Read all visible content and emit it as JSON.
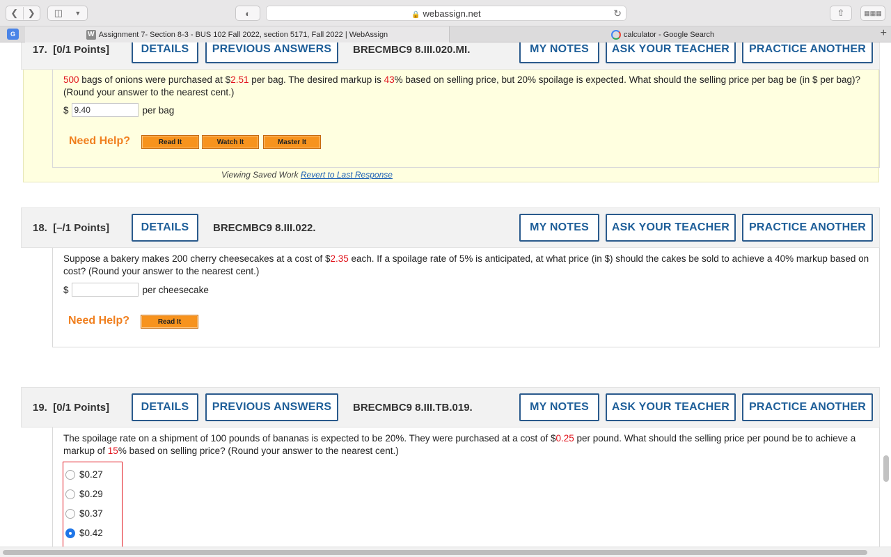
{
  "browser": {
    "url": "webassign.net",
    "tabs": [
      {
        "favicon": "W",
        "title": "Assignment 7- Section 8-3 - BUS 102 Fall 2022, section 5171, Fall 2022 | WebAssign"
      },
      {
        "favicon": "G",
        "title": "calculator - Google Search"
      }
    ],
    "translate_icon": "G"
  },
  "buttons": {
    "details": "DETAILS",
    "previous_answers": "PREVIOUS ANSWERS",
    "my_notes": "MY NOTES",
    "ask_teacher": "ASK YOUR TEACHER",
    "practice_another": "PRACTICE ANOTHER",
    "read_it": "Read It",
    "watch_it": "Watch It",
    "master_it": "Master It"
  },
  "need_help": "Need Help?",
  "questions": [
    {
      "number": "17.",
      "points": "[0/1 Points]",
      "code": "BRECMBC9 8.III.020.MI.",
      "text": {
        "a": "500",
        "b": " bags of onions were purchased at $",
        "c": "2.51",
        "d": " per bag. The desired markup is ",
        "e": "43",
        "f": "% based on selling price, but 20% spoilage is expected. What should the selling price per bag be (in $ per bag)? (Round your answer to the nearest cent.)"
      },
      "currency": "$",
      "answer_value": "9.40",
      "unit": "per bag",
      "saved_note": "Viewing Saved Work",
      "revert_link": "Revert to Last Response"
    },
    {
      "number": "18.",
      "points": "[–/1 Points]",
      "code": "BRECMBC9 8.III.022.",
      "text": {
        "a": "Suppose a bakery makes 200 cherry cheesecakes at a cost of $",
        "b": "2.35",
        "c": " each. If a spoilage rate of 5% is anticipated, at what price (in $) should the cakes be sold to achieve a 40% markup based on cost? (Round your answer to the nearest cent.)"
      },
      "currency": "$",
      "answer_value": "",
      "unit": "per cheesecake"
    },
    {
      "number": "19.",
      "points": "[0/1 Points]",
      "code": "BRECMBC9 8.III.TB.019.",
      "text": {
        "a": "The spoilage rate on a shipment of 100 pounds of bananas is expected to be 20%. They were purchased at a cost of $",
        "b": "0.25",
        "c": " per pound. What should the selling price per pound be to achieve a markup of ",
        "d": "15",
        "e": "% based on selling price? (Round your answer to the nearest cent.)"
      },
      "choices": [
        "$0.27",
        "$0.29",
        "$0.37",
        "$0.42"
      ],
      "selected_choice": "$0.42"
    }
  ]
}
